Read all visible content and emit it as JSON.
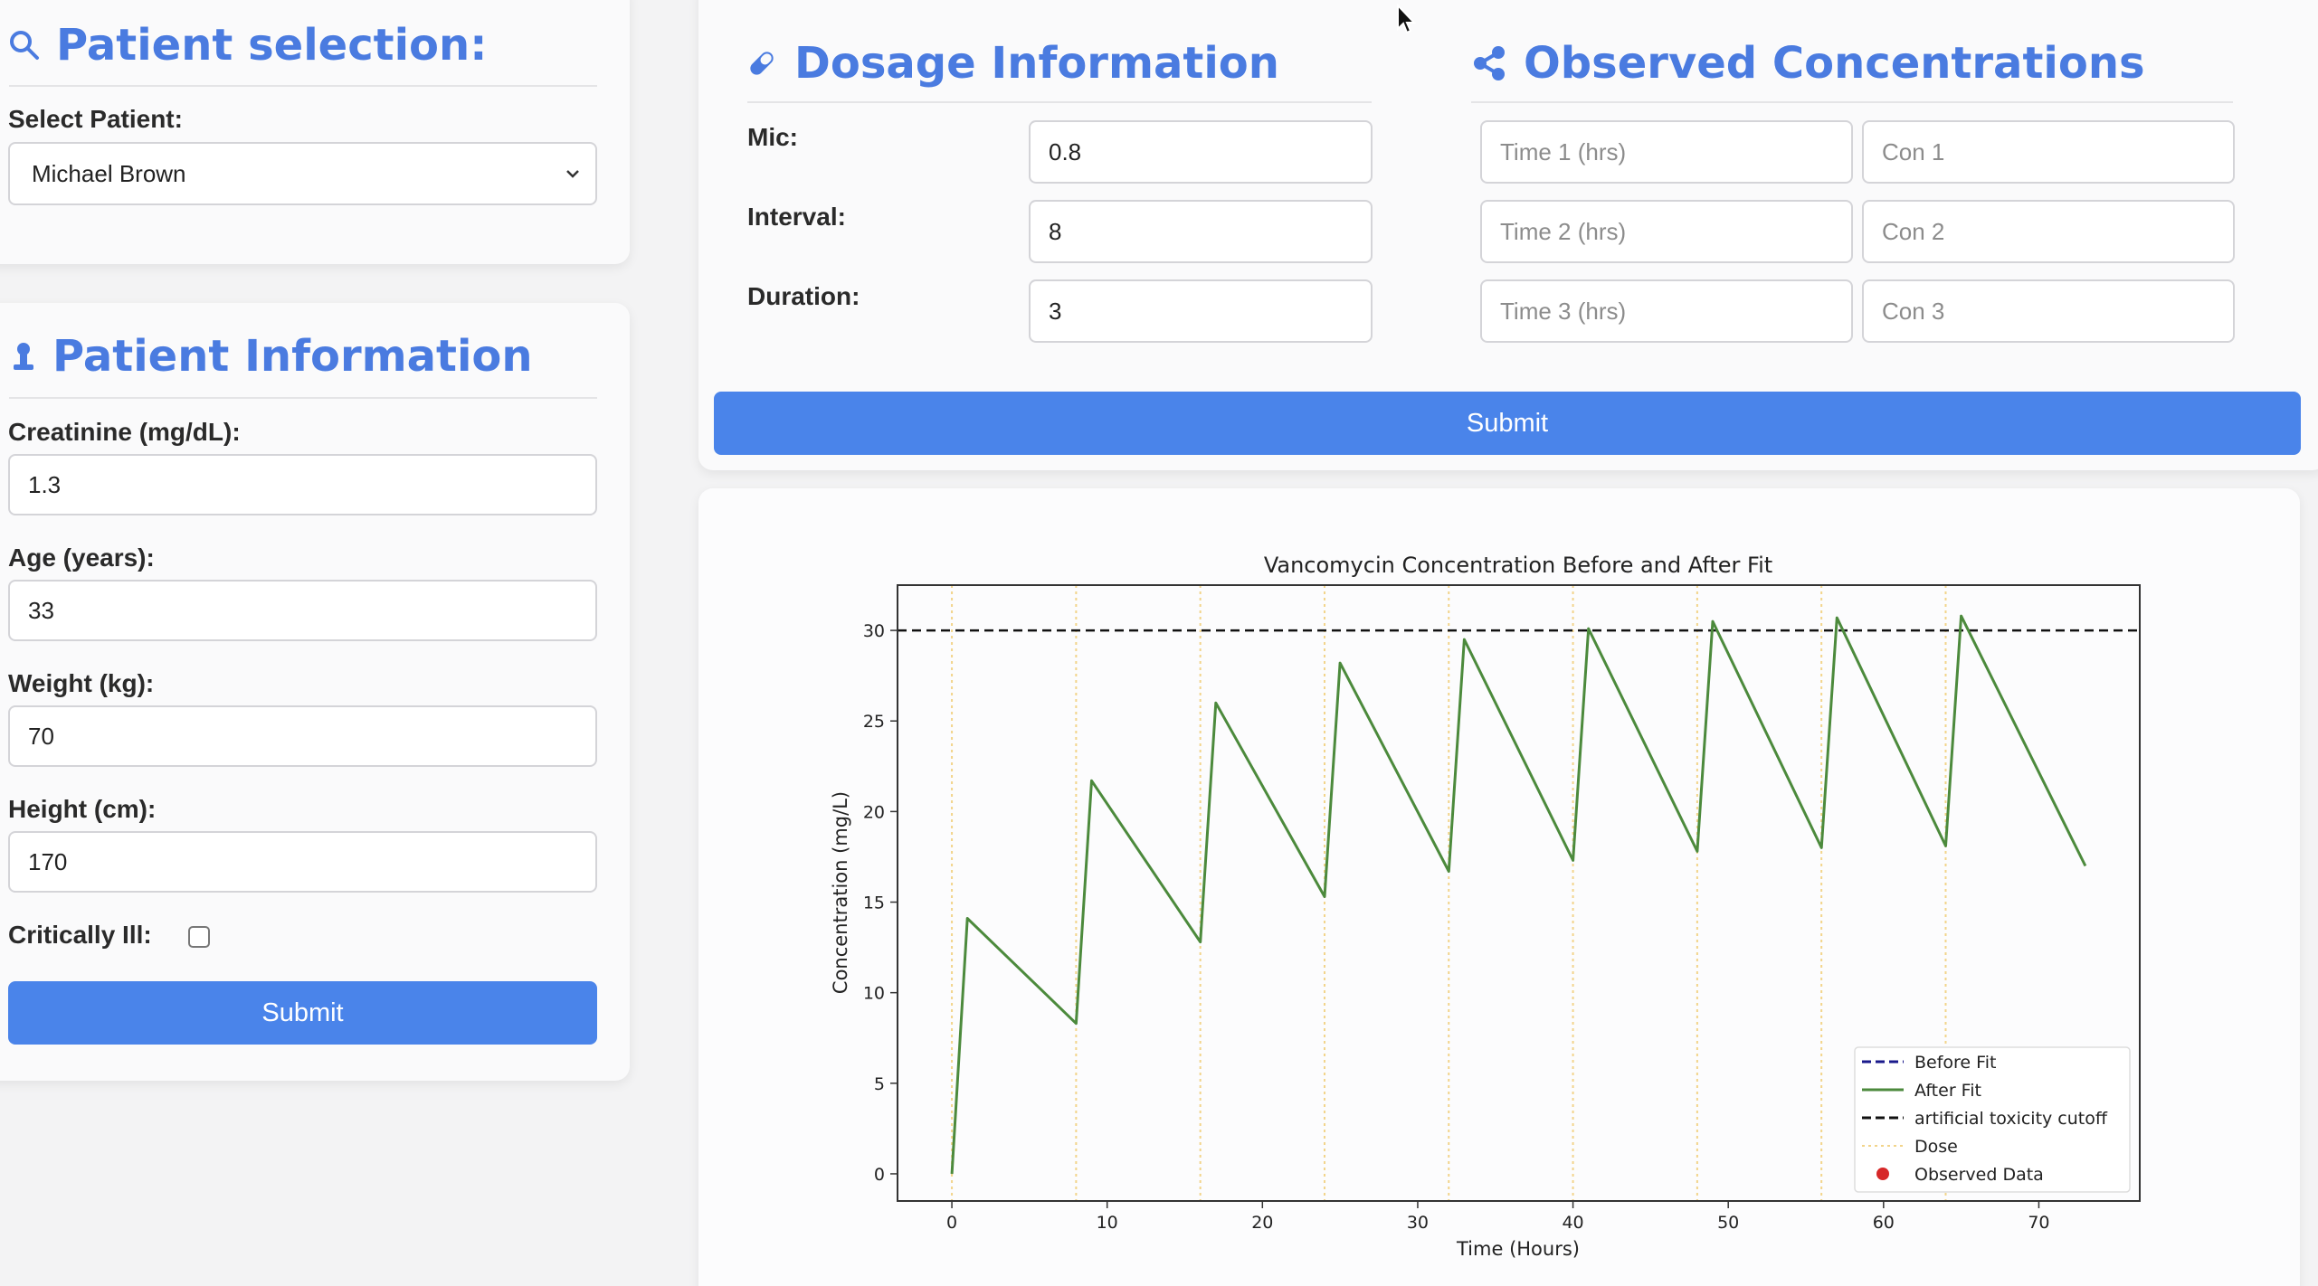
{
  "patient_selection": {
    "title": "Patient selection:",
    "select_label": "Select Patient:",
    "selected_patient": "Michael Brown"
  },
  "patient_info": {
    "title": "Patient Information",
    "creatinine_label": "Creatinine (mg/dL):",
    "creatinine_value": "1.3",
    "age_label": "Age (years):",
    "age_value": "33",
    "weight_label": "Weight (kg):",
    "weight_value": "70",
    "height_label": "Height (cm):",
    "height_value": "170",
    "critically_ill_label": "Critically Ill:",
    "critically_ill_checked": false,
    "submit_label": "Submit"
  },
  "dosage": {
    "title": "Dosage Information",
    "mic_label": "Mic:",
    "mic_value": "0.8",
    "interval_label": "Interval:",
    "interval_value": "8",
    "duration_label": "Duration:",
    "duration_value": "3"
  },
  "observed": {
    "title": "Observed Concentrations",
    "time1_placeholder": "Time 1 (hrs)",
    "con1_placeholder": "Con 1",
    "time2_placeholder": "Time 2 (hrs)",
    "con2_placeholder": "Con 2",
    "time3_placeholder": "Time 3 (hrs)",
    "con3_placeholder": "Con 3"
  },
  "submit_label": "Submit",
  "colors": {
    "accent": "#4a7be0",
    "button": "#4a84ea",
    "after_fit": "#4c8a3c",
    "before_fit": "#1a1a8c",
    "dose": "#f2d48a",
    "observed": "#d62728"
  },
  "chart_data": {
    "type": "line",
    "title": "Vancomycin Concentration Before and After Fit",
    "xlabel": "Time (Hours)",
    "ylabel": "Concentration (mg/L)",
    "xlim": [
      -3.5,
      76.5
    ],
    "ylim": [
      -1.5,
      32.5
    ],
    "xticks": [
      0,
      10,
      20,
      30,
      40,
      50,
      60,
      70
    ],
    "yticks": [
      0,
      5,
      10,
      15,
      20,
      25,
      30
    ],
    "grid": false,
    "legend_position": "lower-right",
    "toxicity_cutoff": 30,
    "dose_times": [
      0,
      8,
      16,
      24,
      32,
      40,
      48,
      56,
      64
    ],
    "series": [
      {
        "name": "After Fit",
        "points": [
          [
            0,
            0
          ],
          [
            1,
            14.1
          ],
          [
            8,
            8.3
          ],
          [
            9,
            21.7
          ],
          [
            16,
            12.8
          ],
          [
            17,
            26.0
          ],
          [
            24,
            15.3
          ],
          [
            25,
            28.2
          ],
          [
            32,
            16.7
          ],
          [
            33,
            29.5
          ],
          [
            40,
            17.3
          ],
          [
            41,
            30.1
          ],
          [
            48,
            17.8
          ],
          [
            49,
            30.5
          ],
          [
            56,
            18.0
          ],
          [
            57,
            30.7
          ],
          [
            64,
            18.1
          ],
          [
            65,
            30.8
          ],
          [
            73,
            17.0
          ]
        ]
      }
    ],
    "legend": [
      "Before Fit",
      "After Fit",
      "artificial toxicity cutoff",
      "Dose",
      "Observed Data"
    ]
  }
}
